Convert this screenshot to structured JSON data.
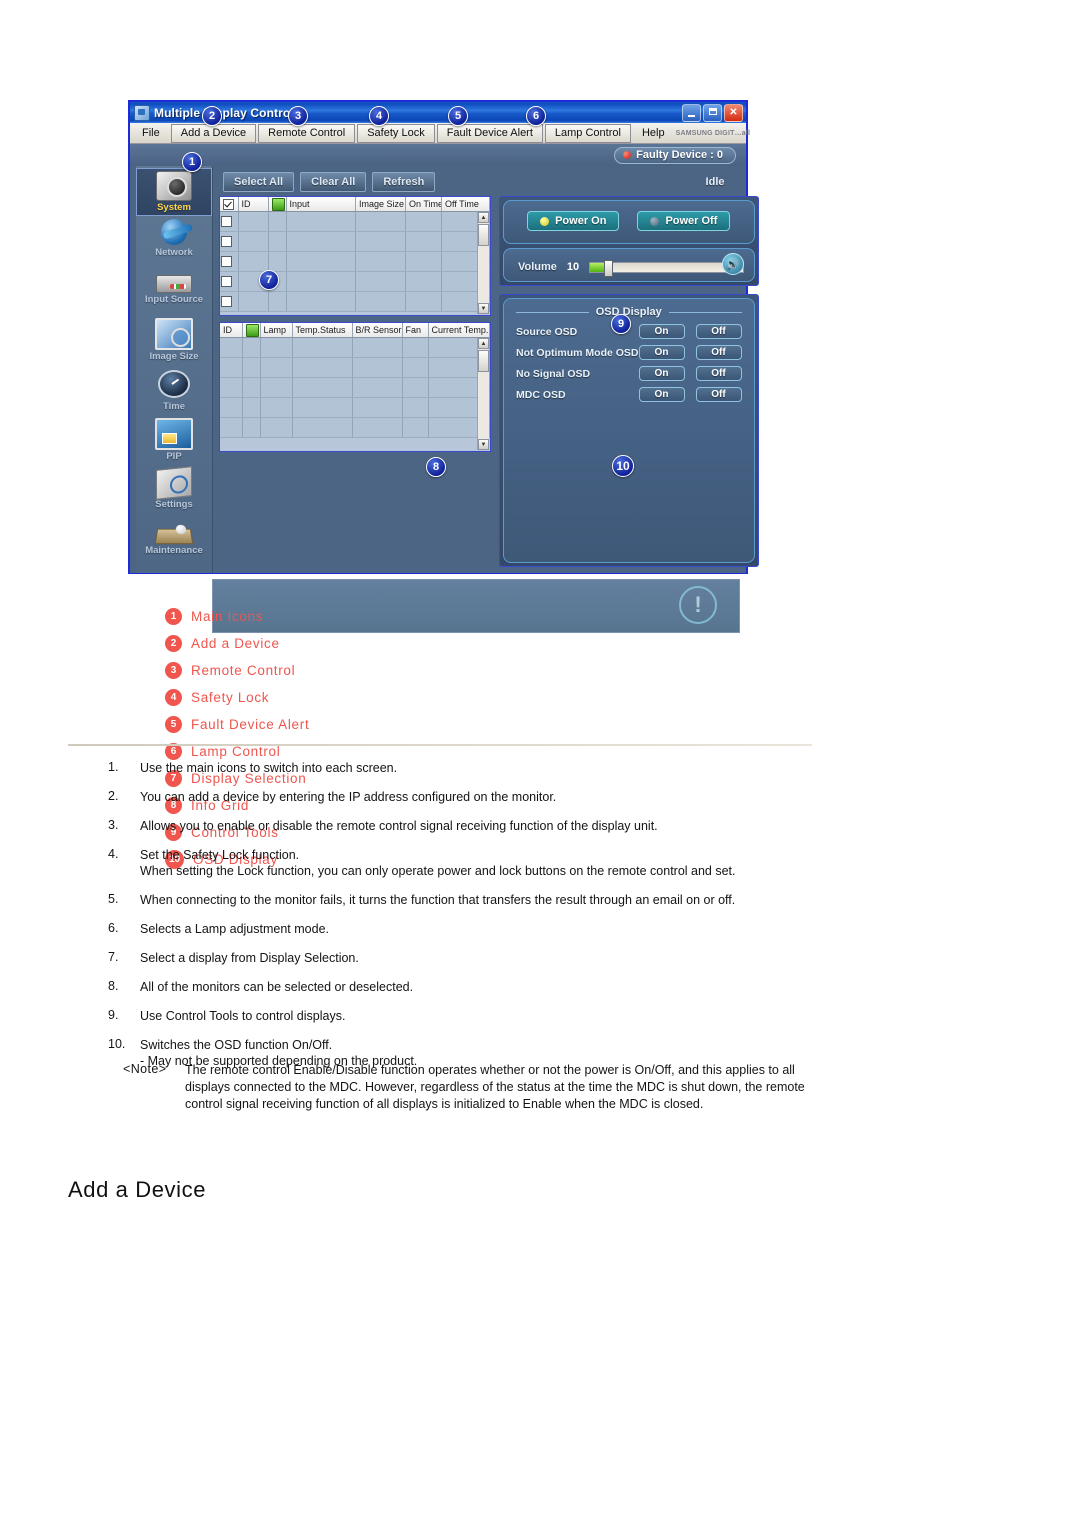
{
  "window": {
    "title": "Multiple Display Control",
    "min_label": "–",
    "max_label": "□",
    "close_label": "✕",
    "brand": "SAMSUNG DIGIT…all",
    "menus": [
      {
        "label": "File",
        "boxed": false
      },
      {
        "label": "Add a Device",
        "boxed": true
      },
      {
        "label": "Remote Control",
        "boxed": true
      },
      {
        "label": "Safety Lock",
        "boxed": true
      },
      {
        "label": "Fault Device Alert",
        "boxed": true
      },
      {
        "label": "Lamp Control",
        "boxed": true
      },
      {
        "label": "Help",
        "boxed": false
      }
    ],
    "faulty_device": "Faulty Device : 0",
    "status": "Idle",
    "toolbar": {
      "select_all": "Select All",
      "clear_all": "Clear All",
      "refresh": "Refresh"
    },
    "sidebar": [
      {
        "label": "System",
        "icon": "camera-system-icon",
        "active": true
      },
      {
        "label": "Network",
        "icon": "globe-network-icon",
        "active": false
      },
      {
        "label": "Input Source",
        "icon": "input-source-icon",
        "active": false
      },
      {
        "label": "Image Size",
        "icon": "image-size-icon",
        "active": false
      },
      {
        "label": "Time",
        "icon": "clock-time-icon",
        "active": false
      },
      {
        "label": "PIP",
        "icon": "pip-monitor-icon",
        "active": false
      },
      {
        "label": "Settings",
        "icon": "settings-cube-icon",
        "active": false
      },
      {
        "label": "Maintenance",
        "icon": "maintenance-icon",
        "active": false
      }
    ],
    "display_grid": {
      "headers": [
        "",
        "ID",
        "",
        "Input",
        "Image Size",
        "On Time",
        "Off Time"
      ],
      "rows": 5
    },
    "info_grid": {
      "headers": [
        "ID",
        "",
        "Lamp",
        "Temp.Status",
        "B/R Sensor",
        "Fan",
        "Current Temp."
      ],
      "rows": 5
    },
    "power": {
      "on_label": "Power On",
      "off_label": "Power Off"
    },
    "volume": {
      "label": "Volume",
      "value": "10"
    },
    "osd": {
      "title": "OSD Display",
      "on_label": "On",
      "off_label": "Off",
      "rows": [
        {
          "label": "Source OSD"
        },
        {
          "label": "Not Optimum Mode OSD"
        },
        {
          "label": "No Signal OSD"
        },
        {
          "label": "MDC OSD"
        }
      ]
    },
    "callouts": [
      {
        "n": "1"
      },
      {
        "n": "2"
      },
      {
        "n": "3"
      },
      {
        "n": "4"
      },
      {
        "n": "5"
      },
      {
        "n": "6"
      },
      {
        "n": "7"
      },
      {
        "n": "8"
      },
      {
        "n": "9"
      },
      {
        "n": "10"
      }
    ]
  },
  "legend": {
    "column1": [
      {
        "num": "1",
        "text": "Main Icons"
      },
      {
        "num": "2",
        "text": "Add a Device"
      },
      {
        "num": "3",
        "text": "Remote Control"
      },
      {
        "num": "4",
        "text": "Safety Lock"
      },
      {
        "num": "5",
        "text": "Fault Device Alert"
      }
    ],
    "column2": [
      {
        "num": "6",
        "text": "Lamp Control"
      },
      {
        "num": "7",
        "text": "Display Selection"
      },
      {
        "num": "8",
        "text": "Info Grid"
      },
      {
        "num": "9",
        "text": "Control Tools"
      },
      {
        "num": "10",
        "text": "OSD Display"
      }
    ]
  },
  "instructions": [
    {
      "num": "1.",
      "text": "Use the main icons to switch into each screen.",
      "sub": ""
    },
    {
      "num": "2.",
      "text": "You can add a device by entering the IP address configured on the monitor.",
      "sub": ""
    },
    {
      "num": "3.",
      "text": "Allows you to enable or disable the remote control signal receiving function of the display unit.",
      "sub": ""
    },
    {
      "num": "4.",
      "text": "Set the Safety Lock function.",
      "sub": "When setting the Lock function, you can only operate power and lock buttons on the remote control and set."
    },
    {
      "num": "5.",
      "text": "When connecting to the monitor fails, it turns the function that transfers the result through an email on or off.",
      "sub": ""
    },
    {
      "num": "6.",
      "text": "Selects a Lamp adjustment mode.",
      "sub": ""
    },
    {
      "num": "7.",
      "text": "Select a display from Display Selection.",
      "sub": ""
    },
    {
      "num": "8.",
      "text": "All of the monitors can be selected or deselected.",
      "sub": ""
    },
    {
      "num": "9.",
      "text": "Use Control Tools to control displays.",
      "sub": ""
    },
    {
      "num": "10.",
      "text": "Switches the OSD function On/Off.",
      "sub": "- May not be supported depending on the product."
    }
  ],
  "note": {
    "label": "<Note>",
    "text": "The remote control Enable/Disable function operates whether or not the power is On/Off, and this applies to all displays connected to the MDC. However, regardless of the status at the time the MDC is shut down, the remote control signal receiving function of all displays is initialized to Enable when the MDC is closed."
  },
  "section_heading": "Add a Device"
}
